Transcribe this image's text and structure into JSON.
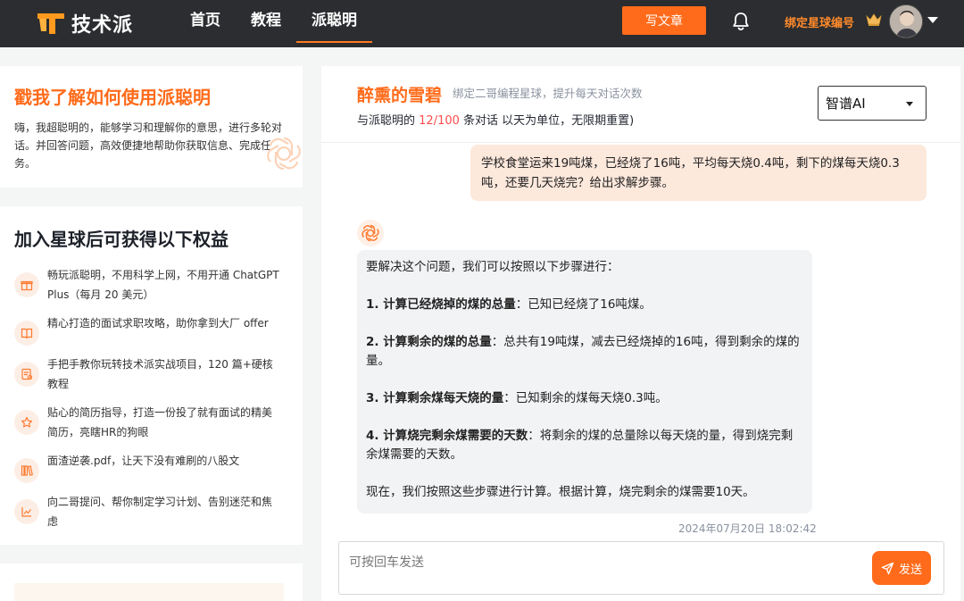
{
  "app": {
    "logo_text": "技术派",
    "brand_color": "#ff6b1a"
  },
  "nav": {
    "items": [
      {
        "label": "首页",
        "active": false
      },
      {
        "label": "教程",
        "active": false
      },
      {
        "label": "派聪明",
        "active": true
      }
    ]
  },
  "header": {
    "write_label": "写文章",
    "bind_label": "绑定星球编号",
    "icons": [
      "bell-icon",
      "crown-icon",
      "avatar",
      "chevron-down-icon"
    ]
  },
  "intro": {
    "title": "戳我了解如何使用派聪明",
    "description": "嗨，我超聪明的，能够学习和理解你的意思，进行多轮对话。并回答问题，高效便捷地帮助你获取信息、完成任务。"
  },
  "benefits": {
    "title": "加入星球后可获得以下权益",
    "items": [
      {
        "icon": "gift-icon",
        "text": "畅玩派聪明，不用科学上网，不用开通 ChatGPT Plus（每月 20 美元）"
      },
      {
        "icon": "book-icon",
        "text": "精心打造的面试求职攻略，助你拿到大厂 offer"
      },
      {
        "icon": "document-icon",
        "text": "手把手教你玩转技术派实战项目，120 篇+硬核教程"
      },
      {
        "icon": "star-icon",
        "text": "贴心的简历指导，打造一份投了就有面试的精美简历，亮瞎HR的狗眼"
      },
      {
        "icon": "library-icon",
        "text": "面渣逆袭.pdf，让天下没有难刷的八股文"
      },
      {
        "icon": "chart-icon",
        "text": "向二哥提问、帮你制定学习计划、告别迷茫和焦虑"
      }
    ]
  },
  "chat": {
    "user_name": "醉熏的雪碧",
    "user_subtitle": "绑定二哥编程星球，提升每天对话次数",
    "quota_prefix": "与派聪明的 ",
    "quota_used": "12",
    "quota_total": "100",
    "quota_suffix": " 条对话 以天为单位，无限期重置)",
    "model": "智谱AI",
    "question": "学校食堂运来19吨煤，已经烧了16吨，平均每天烧0.4吨，剩下的煤每天烧0.3吨，还要几天烧完？给出求解步骤。",
    "answer": {
      "intro": "要解决这个问题，我们可以按照以下步骤进行：",
      "steps": [
        {
          "title": "1. 计算已经烧掉的煤的总量",
          "body": "：已知已经烧了16吨煤。"
        },
        {
          "title": "2. 计算剩余的煤的总量",
          "body": "：总共有19吨煤，减去已经烧掉的16吨，得到剩余的煤的量。"
        },
        {
          "title": "3. 计算剩余煤每天烧的量",
          "body": "：已知剩余的煤每天烧0.3吨。"
        },
        {
          "title": "4. 计算烧完剩余煤需要的天数",
          "body": "：将剩余的煤的总量除以每天烧的量，得到烧完剩余煤需要的天数。"
        }
      ],
      "conclusion": "现在，我们按照这些步骤进行计算。根据计算，烧完剩余的煤需要10天。"
    },
    "timestamp": "2024年07月20日 18:02:42",
    "input_placeholder": "可按回车发送",
    "send_label": "发送"
  }
}
